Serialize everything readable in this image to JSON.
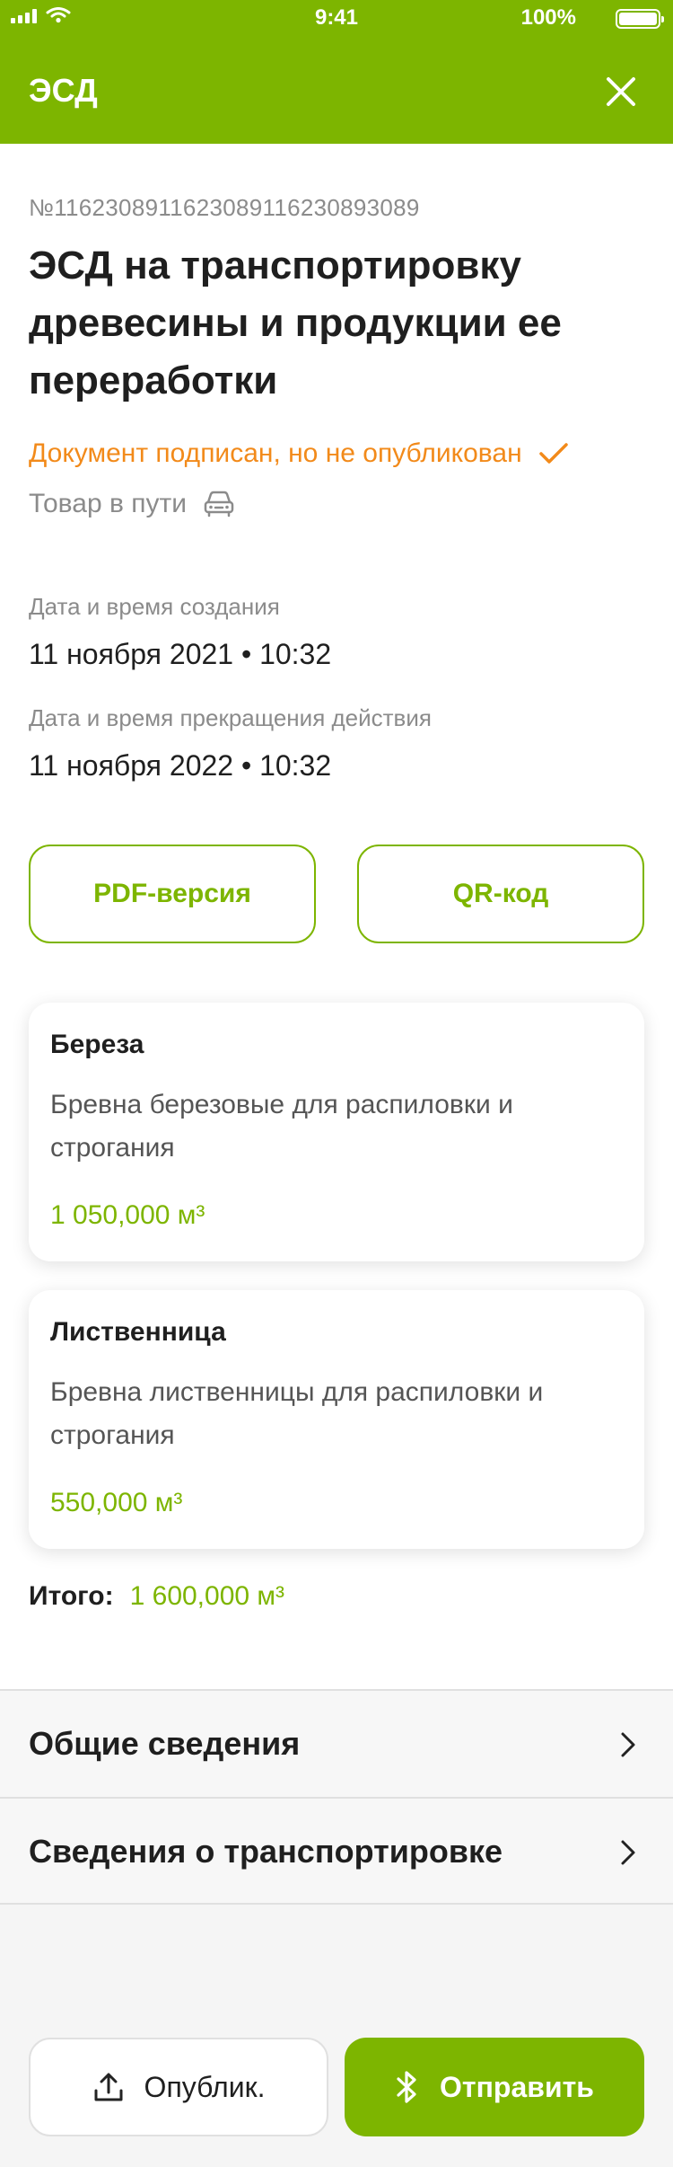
{
  "status_bar": {
    "time": "9:41",
    "battery": "100%"
  },
  "header": {
    "title": "ЭСД"
  },
  "document": {
    "number": "№11623089116230891162308930​89",
    "title": "ЭСД на транспортировку древесины и продукции ее переработки",
    "status_signed": "Документ подписан, но не опубликован",
    "status_transit": "Товар в пути",
    "created_label": "Дата и время создания",
    "created_value": "11 ноября 2021 • 10:32",
    "expires_label": "Дата и время прекращения действия",
    "expires_value": "11 ноября 2022 • 10:32"
  },
  "buttons": {
    "pdf": "PDF-версия",
    "qr": "QR-код"
  },
  "items": [
    {
      "title": "Береза",
      "description": "Бревна березовые для распиловки и строгания",
      "amount": "1 050,000 м³"
    },
    {
      "title": "Лиственница",
      "description": "Бревна лиственницы для распиловки и строгания",
      "amount": "550,000 м³"
    }
  ],
  "total": {
    "label": "Итого:",
    "value": "1 600,000 м³"
  },
  "sections": [
    {
      "label": "Общие сведения"
    },
    {
      "label": "Сведения о транспортировке"
    }
  ],
  "actions": {
    "publish": "Опублик.",
    "send": "Отправить"
  },
  "colors": {
    "accent": "#7db500",
    "warning": "#f28a1a"
  },
  "icons": [
    "close-icon",
    "check-icon",
    "car-icon",
    "chevron-right-icon",
    "upload-icon",
    "bluetooth-icon"
  ]
}
